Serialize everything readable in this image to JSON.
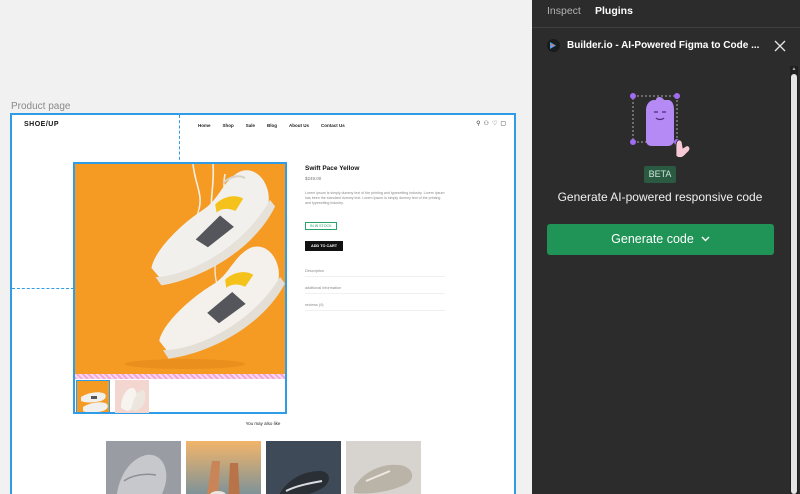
{
  "canvas": {
    "frame_label": "Product page",
    "site": {
      "logo": "SHOE/UP",
      "nav": [
        "Home",
        "Shop",
        "Sale",
        "Blog",
        "About Us",
        "Contact Us"
      ],
      "product_title": "Swift Pace Yellow",
      "price": "$249.00",
      "description": "Lorem ipsum is simply dummy text of the printing and typesetting industry. Lorem Ipsum has been the standard dummy text. Lorem Ipsum is simply dummy text of the printing and typesetting industry.",
      "stock": "IN IN STOCK",
      "add_to_cart": "ADD TO CART",
      "accordion": [
        "Description",
        "additional information",
        "reviews (0)"
      ],
      "you_may_also_like": "You may also like"
    }
  },
  "panel": {
    "tabs": [
      "Inspect",
      "Plugins"
    ],
    "active_tab": "Plugins",
    "plugin_title": "Builder.io - AI-Powered Figma to Code ...",
    "badge": "BETA",
    "headline": "Generate AI-powered responsive code",
    "generate_button": "Generate code",
    "accent_color": "#1f9456",
    "selection_color": "#2f9ce8"
  }
}
